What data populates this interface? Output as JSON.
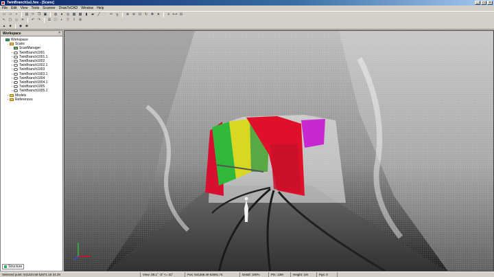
{
  "window": {
    "title": "TwinBranch1a1.fws - [Scans]"
  },
  "menu": [
    "File",
    "Edit",
    "View",
    "Tools",
    "Scanner",
    "DrawToCAD",
    "Window",
    "Help"
  ],
  "sidebar": {
    "header": "Workspace",
    "tab": "Structure",
    "tree": [
      {
        "label": "Workspace",
        "level": 0,
        "icon": "workspace-icon",
        "expand": "-"
      },
      {
        "label": "Scans",
        "level": 1,
        "icon": "folder-icon",
        "expand": "-"
      },
      {
        "label": "ScanManager",
        "level": 2,
        "icon": "scan-manager-icon",
        "expand": ""
      },
      {
        "label": "TwinBranch1001",
        "level": 2,
        "icon": "scan-icon",
        "expand": "+"
      },
      {
        "label": "TwinBranch1001.1",
        "level": 2,
        "icon": "scan-icon",
        "expand": "+"
      },
      {
        "label": "TwinBranch1002",
        "level": 2,
        "icon": "scan-icon",
        "expand": "+"
      },
      {
        "label": "TwinBranch1002.1",
        "level": 2,
        "icon": "scan-icon",
        "expand": "+"
      },
      {
        "label": "TwinBranch1003",
        "level": 2,
        "icon": "scan-icon",
        "expand": "+"
      },
      {
        "label": "TwinBranch1003.1",
        "level": 2,
        "icon": "scan-icon",
        "expand": "+"
      },
      {
        "label": "TwinBranch1004",
        "level": 2,
        "icon": "scan-icon",
        "expand": "+"
      },
      {
        "label": "TwinBranch1004.1",
        "level": 2,
        "icon": "scan-icon",
        "expand": "+"
      },
      {
        "label": "TwinBranch1005",
        "level": 2,
        "icon": "scan-icon",
        "expand": "+"
      },
      {
        "label": "TwinBranch1005.1",
        "level": 2,
        "icon": "scan-icon",
        "expand": "+"
      },
      {
        "label": "Models",
        "level": 1,
        "icon": "folder-icon",
        "expand": "+"
      },
      {
        "label": "References",
        "level": 1,
        "icon": "folder-icon",
        "expand": "+"
      }
    ]
  },
  "statusbar": {
    "selected": "Selected point: 541234.68 52671.15 34.29",
    "view": "View: 29.1° -3° <= 31°",
    "pos": "Pos: 541266.49 52691.74",
    "detail": "Detail: 100%",
    "points": "Pts: 13M",
    "height": "Height: 1M",
    "pages": "Pgs: 0"
  },
  "colors": {
    "title_active": "#0a246a",
    "point_cloud": "#e8e8e8",
    "scan_red": "#e0102a",
    "scan_green": "#2fb83a",
    "scan_yellow": "#d8d820",
    "scan_magenta": "#c828d0"
  }
}
